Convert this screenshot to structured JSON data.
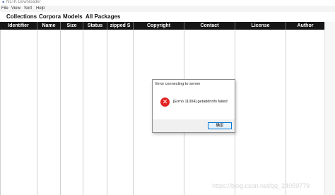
{
  "window": {
    "title": "NLTK Downloader",
    "app_icon": "feather-icon"
  },
  "menu": [
    "File",
    "View",
    "Sort",
    "Help"
  ],
  "tabs": [
    "Collections",
    "Corpora",
    "Models",
    "All Packages"
  ],
  "table": {
    "columns": [
      "Identifier",
      "Name",
      "Size",
      "Status",
      "zipped S",
      "Copyright",
      "Contact",
      "License",
      "Author"
    ]
  },
  "dialog": {
    "title": "Error connecting to server",
    "message": "[Errno 11004] getaddrinfo failed",
    "ok_label": "确定",
    "icon": "error-icon"
  },
  "watermark": "https://blog.csdn.net/qq_24059779"
}
